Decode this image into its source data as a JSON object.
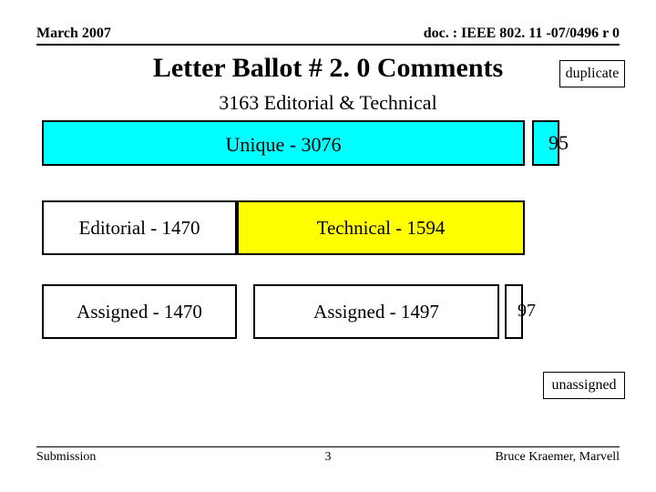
{
  "header": {
    "left": "March 2007",
    "right": "doc. : IEEE 802. 11 -07/0496 r 0"
  },
  "title": "Letter Ballot # 2. 0 Comments",
  "labels": {
    "duplicate": "duplicate",
    "row1": "3163 Editorial & Technical",
    "unique": "Unique - 3076",
    "ninetyfive": "95",
    "editorial": "Editorial - 1470",
    "technical": "Technical - 1594",
    "assigned1": "Assigned - 1470",
    "assigned2": "Assigned - 1497",
    "ninetyseven": "97",
    "unassigned": "unassigned"
  },
  "footer": {
    "left": "Submission",
    "center": "3",
    "right": "Bruce Kraemer, Marvell"
  },
  "chart_data": {
    "type": "diagram",
    "title": "Letter Ballot # 2.0 Comments",
    "total": {
      "label": "Editorial & Technical",
      "value": 3163
    },
    "breakdown": {
      "unique": 3076,
      "duplicate": 95
    },
    "unique_breakdown": {
      "editorial": 1470,
      "technical": 1594
    },
    "assigned": {
      "editorial_assigned": 1470,
      "technical_assigned": 1497,
      "unassigned": 97
    }
  }
}
